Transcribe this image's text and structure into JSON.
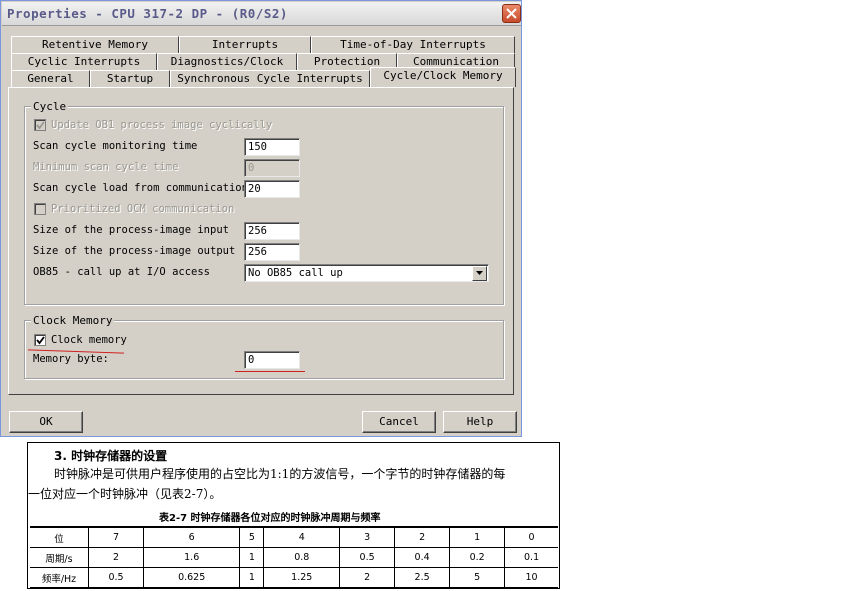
{
  "window": {
    "title": "Properties - CPU 317-2 DP - (R0/S2)"
  },
  "tabs": {
    "row1": [
      "Retentive Memory",
      "Interrupts",
      "Time-of-Day Interrupts"
    ],
    "row2": [
      "Cyclic Interrupts",
      "Diagnostics/Clock",
      "Protection",
      "Communication"
    ],
    "row3": [
      "General",
      "Startup",
      "Synchronous Cycle Interrupts",
      "Cycle/Clock Memory"
    ],
    "active": "Cycle/Clock Memory"
  },
  "cycle": {
    "group_label": "Cycle",
    "update_ob1_label": "Update OB1 process image cyclically",
    "update_ob1_checked": true,
    "scan_monitoring_label": "Scan cycle monitoring time",
    "scan_monitoring_value": "150",
    "min_scan_label": "Minimum scan cycle time",
    "min_scan_value": "0",
    "scan_load_label": "Scan cycle load from communication",
    "scan_load_value": "20",
    "prioritized_ocm_label": "Prioritized OCM communication",
    "prioritized_ocm_checked": false,
    "pi_input_label": "Size of the process-image input",
    "pi_input_value": "256",
    "pi_output_label": "Size of the process-image output",
    "pi_output_value": "256",
    "ob85_label": "OB85 - call up at I/O access",
    "ob85_value": "No OB85 call up"
  },
  "clock_memory": {
    "group_label": "Clock Memory",
    "enable_label": "Clock memory",
    "enable_checked": true,
    "byte_label": "Memory byte:",
    "byte_value": "0"
  },
  "buttons": {
    "ok": "OK",
    "cancel": "Cancel",
    "help": "Help"
  },
  "book": {
    "heading": "3. 时钟存储器的设置",
    "para_line1": "时钟脉冲是可供用户程序使用的占空比为1:1的方波信号，一个字节的时钟存储器的每",
    "para_line2": "一位对应一个时钟脉冲（见表2-7）。",
    "table_caption": "表2-7   时钟存储器各位对应的时钟脉冲周期与频率",
    "table": {
      "header": [
        "位",
        "7",
        "6",
        "5",
        "4",
        "3",
        "2",
        "1",
        "0"
      ],
      "rows": [
        [
          "周期/s",
          "2",
          "1.6",
          "1",
          "0.8",
          "0.5",
          "0.4",
          "0.2",
          "0.1"
        ],
        [
          "频率/Hz",
          "0.5",
          "0.625",
          "1",
          "1.25",
          "2",
          "2.5",
          "5",
          "10"
        ]
      ]
    }
  },
  "colors": {
    "dialog_bg": "#d4d0c8",
    "title_text": "#5a5a8a",
    "close_button": "#c64a2a",
    "annotation_red": "#d02020",
    "disabled_text": "#9a9890"
  }
}
